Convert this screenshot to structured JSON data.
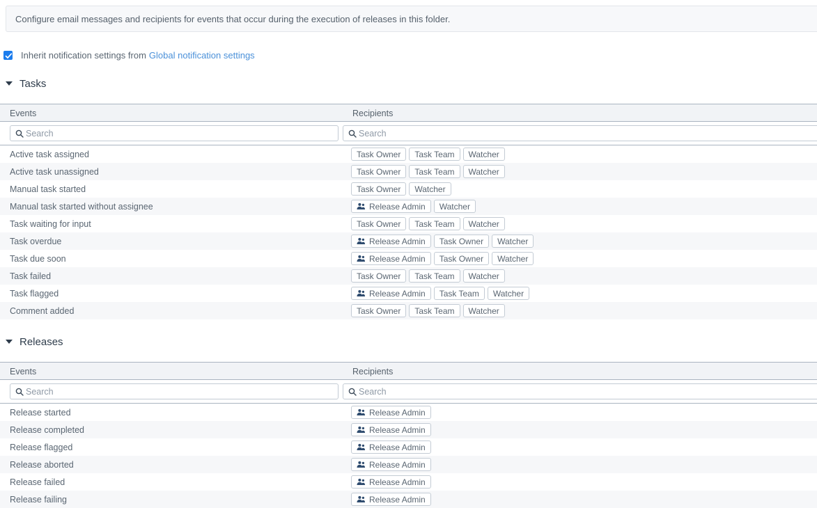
{
  "banner": {
    "text": "Configure email messages and recipients for events that occur during the execution of releases in this folder."
  },
  "inherit": {
    "label": "Inherit notification settings from",
    "link_label": "Global notification settings",
    "checked": true
  },
  "colors": {
    "accent": "#1b7ced",
    "link": "#4a90d9",
    "header_bg": "#f1f3f6",
    "row_alt_bg": "#f6f7f9",
    "border": "#aab4c0",
    "text": "#5a6672",
    "title": "#2e3c4b"
  },
  "icons": {
    "search": "search-icon",
    "group": "users-group-icon",
    "caret": "caret-down-icon",
    "check": "check-icon"
  },
  "sections": [
    {
      "id": "tasks",
      "title": "Tasks",
      "columns": {
        "events": "Events",
        "recipients": "Recipients"
      },
      "search": {
        "events_placeholder": "Search",
        "events_value": "",
        "recipients_placeholder": "Search",
        "recipients_value": ""
      },
      "rows": [
        {
          "event": "Active task assigned",
          "recipients": [
            {
              "label": "Task Owner",
              "icon": false
            },
            {
              "label": "Task Team",
              "icon": false
            },
            {
              "label": "Watcher",
              "icon": false
            }
          ]
        },
        {
          "event": "Active task unassigned",
          "recipients": [
            {
              "label": "Task Owner",
              "icon": false
            },
            {
              "label": "Task Team",
              "icon": false
            },
            {
              "label": "Watcher",
              "icon": false
            }
          ]
        },
        {
          "event": "Manual task started",
          "recipients": [
            {
              "label": "Task Owner",
              "icon": false
            },
            {
              "label": "Watcher",
              "icon": false
            }
          ]
        },
        {
          "event": "Manual task started without assignee",
          "recipients": [
            {
              "label": "Release Admin",
              "icon": true
            },
            {
              "label": "Watcher",
              "icon": false
            }
          ]
        },
        {
          "event": "Task waiting for input",
          "recipients": [
            {
              "label": "Task Owner",
              "icon": false
            },
            {
              "label": "Task Team",
              "icon": false
            },
            {
              "label": "Watcher",
              "icon": false
            }
          ]
        },
        {
          "event": "Task overdue",
          "recipients": [
            {
              "label": "Release Admin",
              "icon": true
            },
            {
              "label": "Task Owner",
              "icon": false
            },
            {
              "label": "Watcher",
              "icon": false
            }
          ]
        },
        {
          "event": "Task due soon",
          "recipients": [
            {
              "label": "Release Admin",
              "icon": true
            },
            {
              "label": "Task Owner",
              "icon": false
            },
            {
              "label": "Watcher",
              "icon": false
            }
          ]
        },
        {
          "event": "Task failed",
          "recipients": [
            {
              "label": "Task Owner",
              "icon": false
            },
            {
              "label": "Task Team",
              "icon": false
            },
            {
              "label": "Watcher",
              "icon": false
            }
          ]
        },
        {
          "event": "Task flagged",
          "recipients": [
            {
              "label": "Release Admin",
              "icon": true
            },
            {
              "label": "Task Team",
              "icon": false
            },
            {
              "label": "Watcher",
              "icon": false
            }
          ]
        },
        {
          "event": "Comment added",
          "recipients": [
            {
              "label": "Task Owner",
              "icon": false
            },
            {
              "label": "Task Team",
              "icon": false
            },
            {
              "label": "Watcher",
              "icon": false
            }
          ]
        }
      ]
    },
    {
      "id": "releases",
      "title": "Releases",
      "columns": {
        "events": "Events",
        "recipients": "Recipients"
      },
      "search": {
        "events_placeholder": "Search",
        "events_value": "",
        "recipients_placeholder": "Search",
        "recipients_value": ""
      },
      "rows": [
        {
          "event": "Release started",
          "recipients": [
            {
              "label": "Release Admin",
              "icon": true
            }
          ]
        },
        {
          "event": "Release completed",
          "recipients": [
            {
              "label": "Release Admin",
              "icon": true
            }
          ]
        },
        {
          "event": "Release flagged",
          "recipients": [
            {
              "label": "Release Admin",
              "icon": true
            }
          ]
        },
        {
          "event": "Release aborted",
          "recipients": [
            {
              "label": "Release Admin",
              "icon": true
            }
          ]
        },
        {
          "event": "Release failed",
          "recipients": [
            {
              "label": "Release Admin",
              "icon": true
            }
          ]
        },
        {
          "event": "Release failing",
          "recipients": [
            {
              "label": "Release Admin",
              "icon": true
            }
          ]
        }
      ]
    }
  ]
}
